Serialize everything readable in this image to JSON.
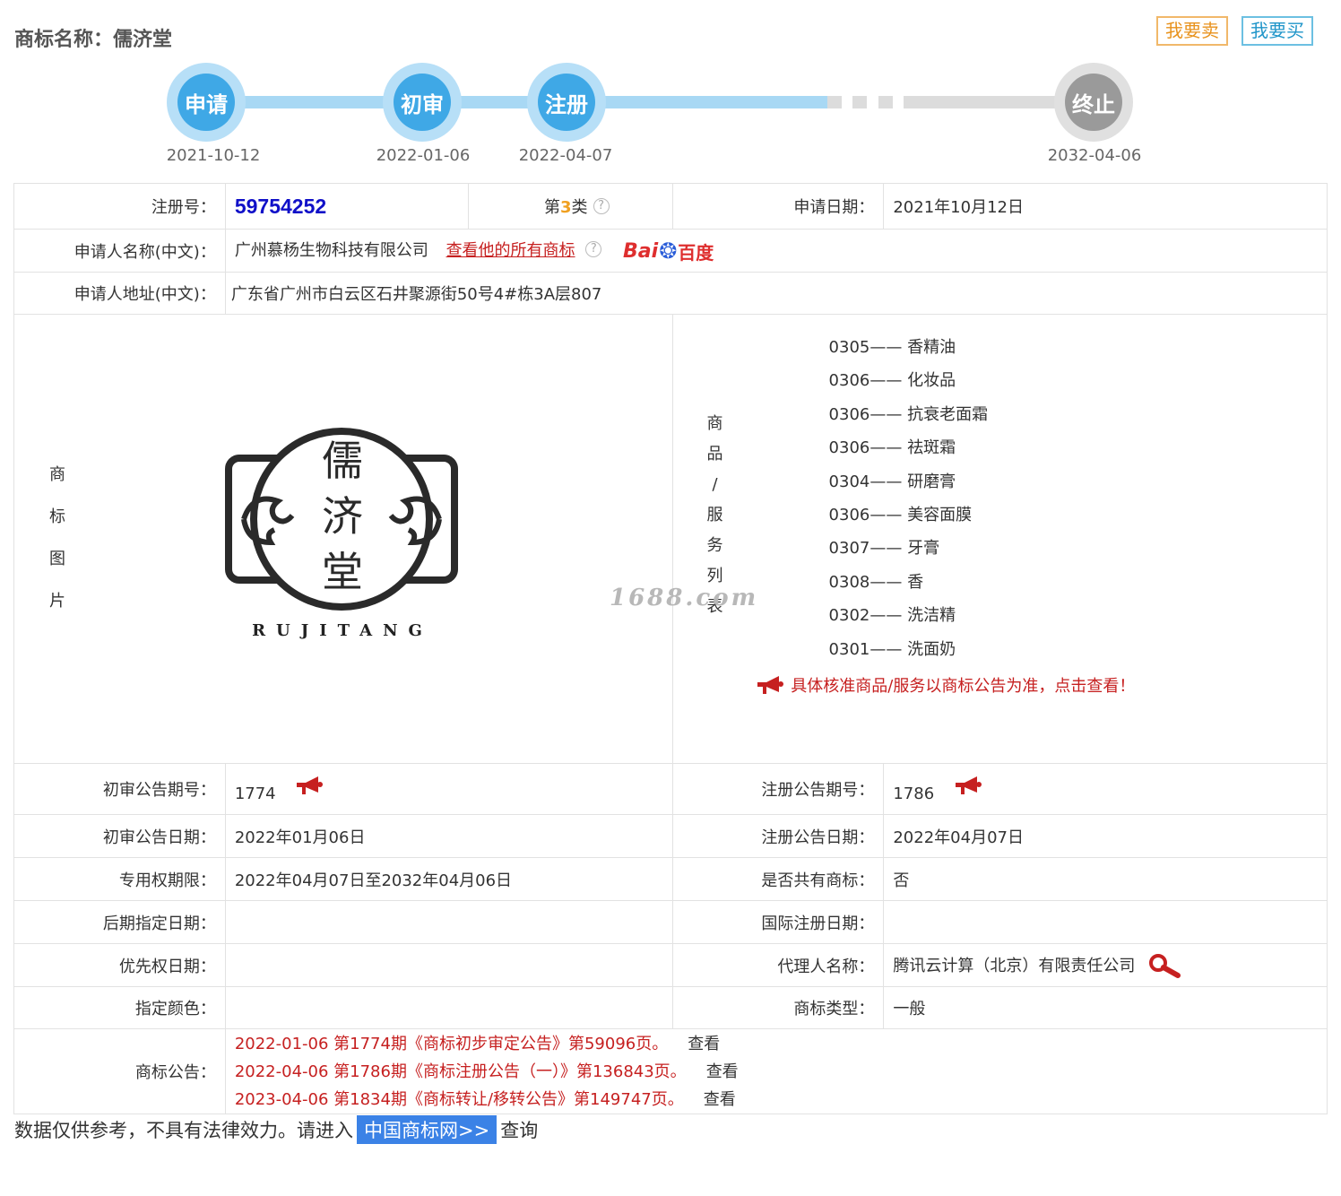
{
  "header": {
    "title": "商标名称：儒济堂",
    "sell_label": "我要卖",
    "buy_label": "我要买"
  },
  "timeline": [
    {
      "label": "申请",
      "date": "2021-10-12",
      "state": "active"
    },
    {
      "label": "初审",
      "date": "2022-01-06",
      "state": "active"
    },
    {
      "label": "注册",
      "date": "2022-04-07",
      "state": "active"
    },
    {
      "label": "终止",
      "date": "2032-04-06",
      "state": "inactive"
    }
  ],
  "info": {
    "reg_no_label": "注册号：",
    "reg_no": "59754252",
    "class_prefix": "第",
    "class_num": "3",
    "class_suffix": "类",
    "apply_date_label": "申请日期：",
    "apply_date": "2021年10月12日",
    "applicant_label": "申请人名称(中文)：",
    "applicant": "广州慕杨生物科技有限公司",
    "all_marks_link": "查看他的所有商标",
    "baidu_bai": "Bai",
    "baidu_du": "百度",
    "address_label": "申请人地址(中文)：",
    "address": "广东省广州市白云区石井聚源街50号4#栋3A层807",
    "image_label": [
      "商",
      "标",
      "图",
      "片"
    ],
    "logo_text": "RUJITANG",
    "logo_chars": [
      "儒",
      "济",
      "堂"
    ],
    "goods_label": [
      "商",
      "品",
      "/",
      "服",
      "务",
      "列",
      "表"
    ],
    "goods": [
      "0305—— 香精油",
      "0306—— 化妆品",
      "0306—— 抗衰老面霜",
      "0306—— 祛斑霜",
      "0304—— 研磨膏",
      "0306—— 美容面膜",
      "0307—— 牙膏",
      "0308—— 香",
      "0302—— 洗洁精",
      "0301—— 洗面奶"
    ],
    "goods_notice": "具体核准商品/服务以商标公告为准，点击查看！",
    "watermark": "1688.com",
    "prelim_no_label": "初审公告期号：",
    "prelim_no": "1774",
    "reg_pub_no_label": "注册公告期号：",
    "reg_pub_no": "1786",
    "prelim_date_label": "初审公告日期：",
    "prelim_date": "2022年01月06日",
    "reg_pub_date_label": "注册公告日期：",
    "reg_pub_date": "2022年04月07日",
    "term_label": "专用权期限：",
    "term": "2022年04月07日至2032年04月06日",
    "shared_label": "是否共有商标：",
    "shared": "否",
    "later_date_label": "后期指定日期：",
    "later_date": "",
    "intl_date_label": "国际注册日期：",
    "intl_date": "",
    "priority_label": "优先权日期：",
    "priority": "",
    "agent_label": "代理人名称：",
    "agent": "腾讯云计算（北京）有限责任公司",
    "color_label": "指定颜色：",
    "color": "",
    "type_label": "商标类型：",
    "type": "一般",
    "announce_label": "商标公告：",
    "announcements": [
      {
        "text": "2022-01-06 第1774期《商标初步审定公告》第59096页。",
        "action": "查看"
      },
      {
        "text": "2022-04-06 第1786期《商标注册公告（一）》第136843页。",
        "action": "查看"
      },
      {
        "text": "2023-04-06 第1834期《商标转让/移转公告》第149747页。",
        "action": "查看"
      }
    ]
  },
  "footer": {
    "prefix": "数据仅供参考，不具有法律效力。请进入",
    "link": "中国商标网>>",
    "suffix": "查询"
  },
  "colors": {
    "timeline_active": "#3fa8e6",
    "timeline_inactive": "#9a9a9a",
    "reg_no": "#1010c8",
    "alert_red": "#c62020",
    "link_blue": "#3b82e6"
  }
}
